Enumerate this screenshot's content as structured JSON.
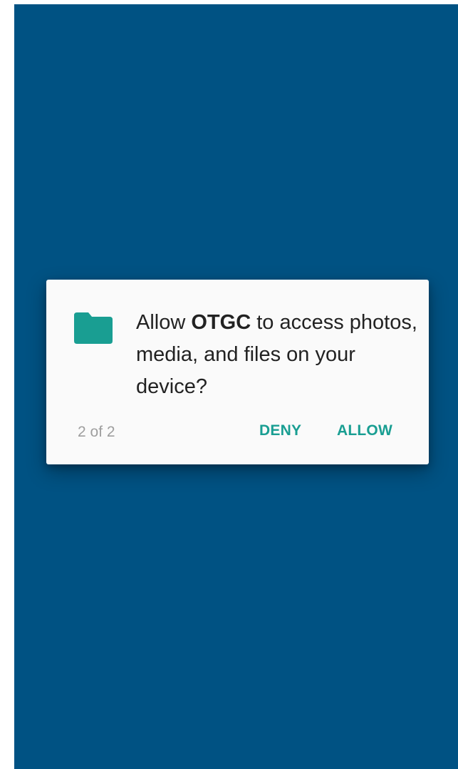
{
  "dialog": {
    "icon": "folder-icon",
    "message_prefix": "Allow ",
    "app_name": "OTGC",
    "message_suffix": " to access photos, media, and files on your device?",
    "counter": "2 of 2",
    "deny_label": "DENY",
    "allow_label": "ALLOW"
  },
  "colors": {
    "background": "#005283",
    "dialog": "#fafafa",
    "accent": "#199e92",
    "counter_text": "#9e9e9e",
    "body_text": "#222222"
  }
}
